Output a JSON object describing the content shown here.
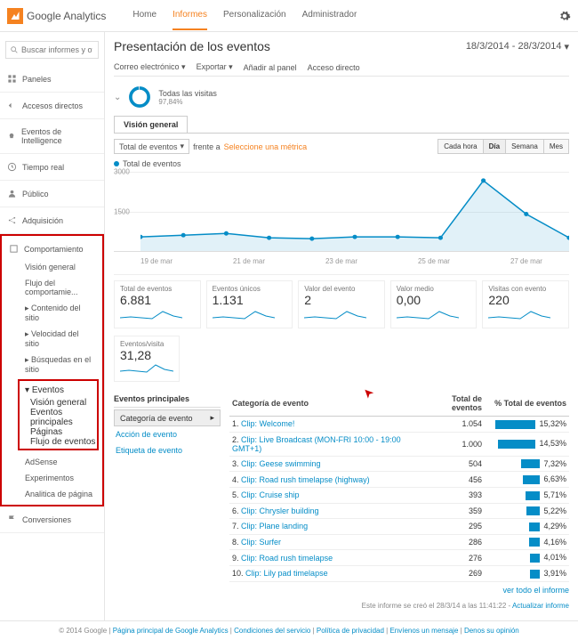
{
  "brand": "Google Analytics",
  "topnav": [
    "Home",
    "Informes",
    "Personalización",
    "Administrador"
  ],
  "topnav_active": 1,
  "search_placeholder": "Buscar informes y otros",
  "sidebar": {
    "groups": [
      {
        "icon": "dashboard",
        "label": "Paneles"
      },
      {
        "icon": "arrow-left",
        "label": "Accesos directos"
      },
      {
        "icon": "bulb",
        "label": "Eventos de Intelligence"
      },
      {
        "icon": "clock",
        "label": "Tiempo real"
      },
      {
        "icon": "person",
        "label": "Público"
      },
      {
        "icon": "share",
        "label": "Adquisición"
      }
    ],
    "behavior": {
      "icon": "square",
      "label": "Comportamiento",
      "items": [
        {
          "label": "Visión general"
        },
        {
          "label": "Flujo del comportamie..."
        },
        {
          "label": "Contenido del sitio",
          "exp": true
        },
        {
          "label": "Velocidad del sitio",
          "exp": true
        },
        {
          "label": "Búsquedas en el sitio",
          "exp": true
        }
      ],
      "events": {
        "label": "Eventos",
        "items": [
          "Visión general",
          "Eventos principales",
          "Páginas",
          "Flujo de eventos"
        ]
      },
      "tail": [
        "AdSense",
        "Experimentos",
        "Analitica de página"
      ]
    },
    "conversions": {
      "icon": "flag",
      "label": "Conversiones"
    }
  },
  "page_title": "Presentación de los eventos",
  "daterange": "18/3/2014 - 28/3/2014",
  "toolbar": [
    "Correo electrónico",
    "Exportar",
    "Añadir al panel",
    "Acceso directo"
  ],
  "visits": {
    "label": "Todas las visitas",
    "pct": "97,84%"
  },
  "tab": "Visión general",
  "compare": {
    "selector": "Total de eventos",
    "vs": "frente a",
    "pick": "Seleccione una métrica"
  },
  "timegran": [
    "Cada hora",
    "Día",
    "Semana",
    "Mes"
  ],
  "timegran_active": 1,
  "legend": "Total de eventos",
  "chart_data": {
    "type": "line",
    "title": "Total de eventos",
    "xlabel": "",
    "ylabel": "",
    "ylim": [
      0,
      3000
    ],
    "yticks": [
      1500,
      3000
    ],
    "x": [
      "19 de mar",
      "21 de mar",
      "23 de mar",
      "25 de mar",
      "27 de mar"
    ],
    "series": [
      {
        "name": "Total de eventos",
        "values": [
          550,
          620,
          680,
          500,
          480,
          550,
          520,
          500,
          2650,
          1400,
          500
        ]
      }
    ]
  },
  "metrics": [
    {
      "label": "Total de eventos",
      "value": "6.881"
    },
    {
      "label": "Eventos únicos",
      "value": "1.131"
    },
    {
      "label": "Valor del evento",
      "value": "2"
    },
    {
      "label": "Valor medio",
      "value": "0,00"
    },
    {
      "label": "Visitas con evento",
      "value": "220"
    }
  ],
  "events_per_visit": {
    "label": "Eventos/visita",
    "value": "31,28"
  },
  "left_panel": {
    "title": "Eventos principales",
    "cat": "Categoría de evento",
    "links": [
      "Acción de evento",
      "Etiqueta de evento"
    ]
  },
  "table": {
    "headers": [
      "Categoría de evento",
      "Total de eventos",
      "% Total de eventos"
    ],
    "rows": [
      {
        "n": "1.",
        "name": "Clip: Welcome!",
        "total": "1.054",
        "pct": "15,32%",
        "bar": 100
      },
      {
        "n": "2.",
        "name": "Clip: Live Broadcast (MON-FRI 10:00 - 19:00 GMT+1)",
        "total": "1.000",
        "pct": "14,53%",
        "bar": 95
      },
      {
        "n": "3.",
        "name": "Clip: Geese swimming",
        "total": "504",
        "pct": "7,32%",
        "bar": 48
      },
      {
        "n": "4.",
        "name": "Clip: Road rush timelapse (highway)",
        "total": "456",
        "pct": "6,63%",
        "bar": 43
      },
      {
        "n": "5.",
        "name": "Clip: Cruise ship",
        "total": "393",
        "pct": "5,71%",
        "bar": 37
      },
      {
        "n": "6.",
        "name": "Clip: Chrysler building",
        "total": "359",
        "pct": "5,22%",
        "bar": 34
      },
      {
        "n": "7.",
        "name": "Clip: Plane landing",
        "total": "295",
        "pct": "4,29%",
        "bar": 28
      },
      {
        "n": "8.",
        "name": "Clip: Surfer",
        "total": "286",
        "pct": "4,16%",
        "bar": 27
      },
      {
        "n": "9.",
        "name": "Clip: Road rush timelapse",
        "total": "276",
        "pct": "4,01%",
        "bar": 26
      },
      {
        "n": "10.",
        "name": "Clip: Lily pad timelapse",
        "total": "269",
        "pct": "3,91%",
        "bar": 25
      }
    ],
    "see_all": "ver todo el informe"
  },
  "generated": {
    "text": "Este informe se creó el 28/3/14 a las 11:41:22 -",
    "link": "Actualizar informe"
  },
  "footer": {
    "copy": "© 2014 Google",
    "links": [
      "Página principal de Google Analytics",
      "Condiciones del servicio",
      "Política de privacidad",
      "Envíenos un mensaje",
      "Denos su opinión"
    ]
  }
}
